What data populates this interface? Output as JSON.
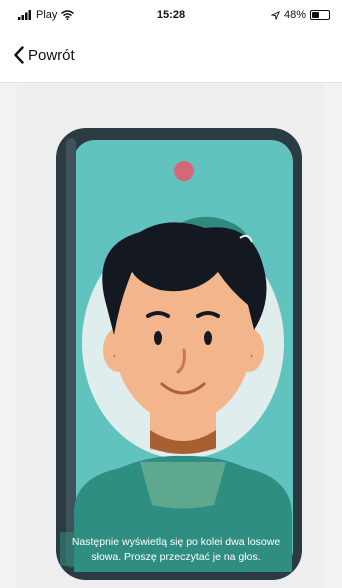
{
  "status_bar": {
    "carrier": "Play",
    "time": "15:28",
    "battery": "48%",
    "battery_level": 0.48,
    "icons": [
      "signal-bars-icon",
      "wifi-icon",
      "location-arrow-icon",
      "battery-icon"
    ]
  },
  "nav": {
    "back_label": "Powrót",
    "back_icon": "chevron-left-icon"
  },
  "illustration": {
    "caption": "Następnie wyświetlą się po kolei dwa losowe słowa. Proszę przeczytać je na głos.",
    "colors": {
      "screen": "#61c3bd",
      "frame": "#2b3b42",
      "camera_dot": "#d6667a",
      "face_oval": "#dfedec",
      "skin": "#f3b58b",
      "hair": "#141821",
      "shirt": "#2f8e82"
    }
  }
}
